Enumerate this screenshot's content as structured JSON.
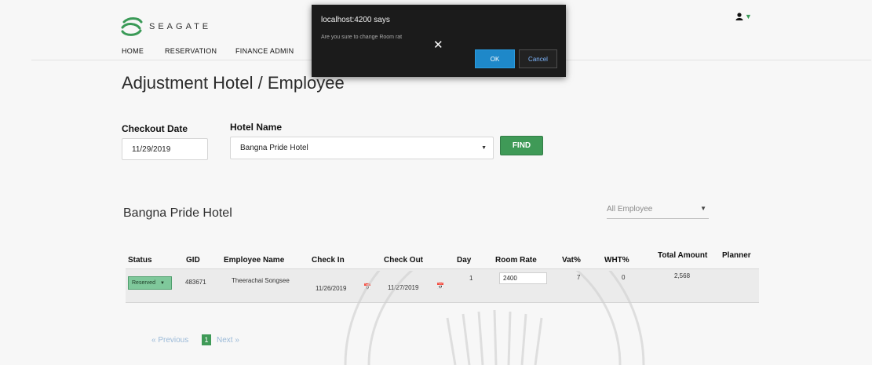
{
  "header": {
    "logo_text": "SEAGATE",
    "nav": [
      "HOME",
      "RESERVATION",
      "FINANCE ADMIN"
    ],
    "user_icon": "user-icon",
    "caret_icon": "caret-down-icon"
  },
  "page": {
    "title": "Adjustment Hotel / Employee"
  },
  "search": {
    "checkout_label": "Checkout Date",
    "checkout_value": "11/29/2019",
    "hotel_label": "Hotel Name",
    "hotel_value": "Bangna Pride Hotel",
    "find_label": "FIND"
  },
  "results": {
    "hotel_heading": "Bangna Pride Hotel",
    "employee_filter": "All Employee"
  },
  "table": {
    "headers": [
      "Status",
      "GID",
      "Employee Name",
      "Check In",
      "Check Out",
      "Day",
      "Room Rate",
      "Vat%",
      "WHT%",
      "Total Amount",
      "Planner"
    ],
    "rows": [
      {
        "status": "Reserved",
        "gid": "483671",
        "employee_name": "Theerachai Songsee",
        "check_in": "11/26/2019",
        "check_out": "11/27/2019",
        "day": "1",
        "room_rate": "2400",
        "vat": "7",
        "wht": "0",
        "total_amount": "2,568",
        "planner": ""
      }
    ]
  },
  "pagination": {
    "previous": "« Previous",
    "current": "1",
    "next": "Next »"
  },
  "dialog": {
    "title": "localhost:4200 says",
    "message": "Are you sure to change Room rat",
    "ok_label": "OK",
    "cancel_label": "Cancel"
  },
  "colors": {
    "accent_green": "#3f9a57",
    "status_green": "#7fc89b",
    "dialog_bg": "#1b1b1b",
    "dialog_ok": "#1e88c9"
  }
}
